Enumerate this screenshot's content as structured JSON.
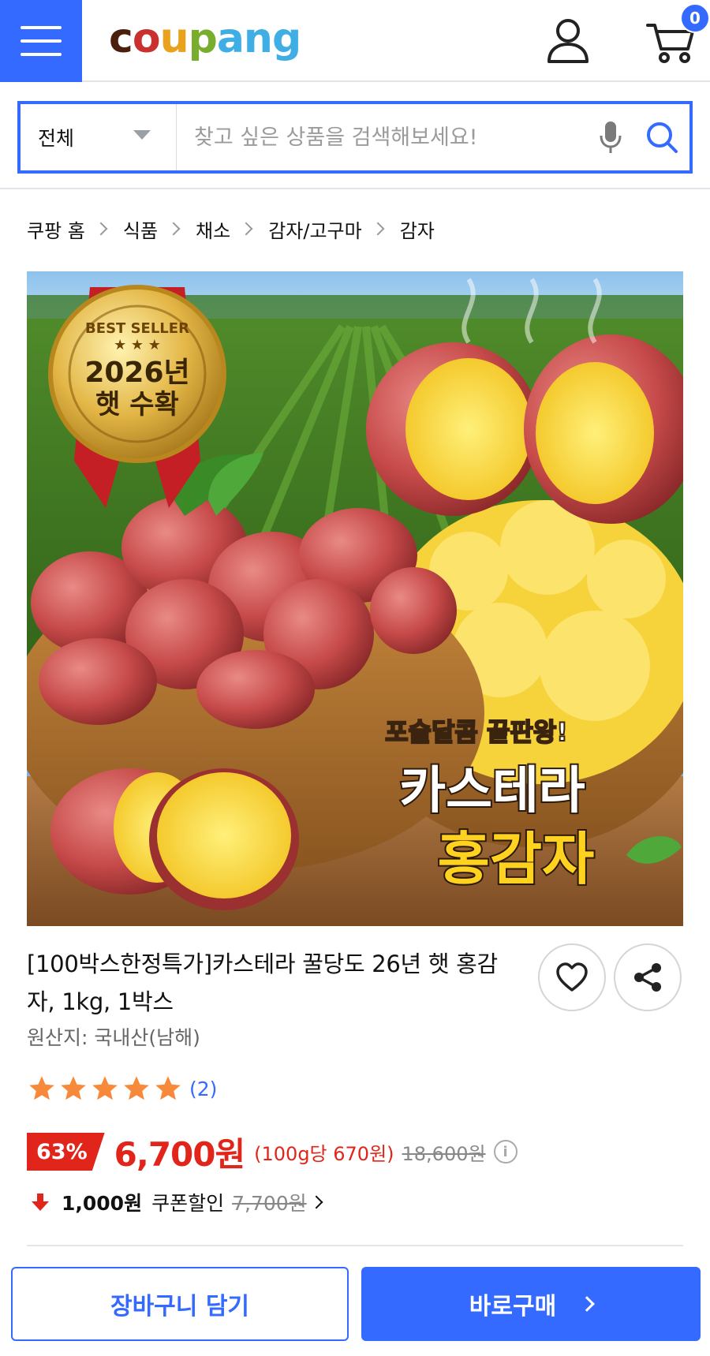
{
  "header": {
    "logo": [
      "c",
      "o",
      "u",
      "p",
      "a",
      "n",
      "g"
    ],
    "cart_count": "0",
    "colors": {
      "brand_blue": "#346aff",
      "discount_red": "#e1251b"
    }
  },
  "search": {
    "category": "전체",
    "placeholder": "찾고 싶은 상품을 검색해보세요!",
    "value": ""
  },
  "breadcrumb": [
    "쿠팡 홈",
    "식품",
    "채소",
    "감자/고구마",
    "감자"
  ],
  "product_image": {
    "badge_top": "BEST SELLER",
    "badge_year": "2026년",
    "badge_harvest": "햇 수확",
    "tagline": "포슬달콤 끝판왕!",
    "headline_1": "카스테라",
    "headline_2": "홍감자"
  },
  "product": {
    "title": "[100박스한정특가]카스테라 꿀당도 26년 햇 홍감자, 1kg, 1박스",
    "origin": "원산지: 국내산(남해)",
    "rating": 5,
    "review_count": "(2)"
  },
  "price": {
    "discount": "63%",
    "sale_price": "6,700원",
    "unit_price": "(100g당 670원)",
    "original_price": "18,600원",
    "info": "i"
  },
  "coupon": {
    "amount": "1,000원",
    "label": "쿠폰할인",
    "before_price": "7,700원"
  },
  "actions": {
    "add_to_cart": "장바구니 담기",
    "buy_now": "바로구매"
  }
}
